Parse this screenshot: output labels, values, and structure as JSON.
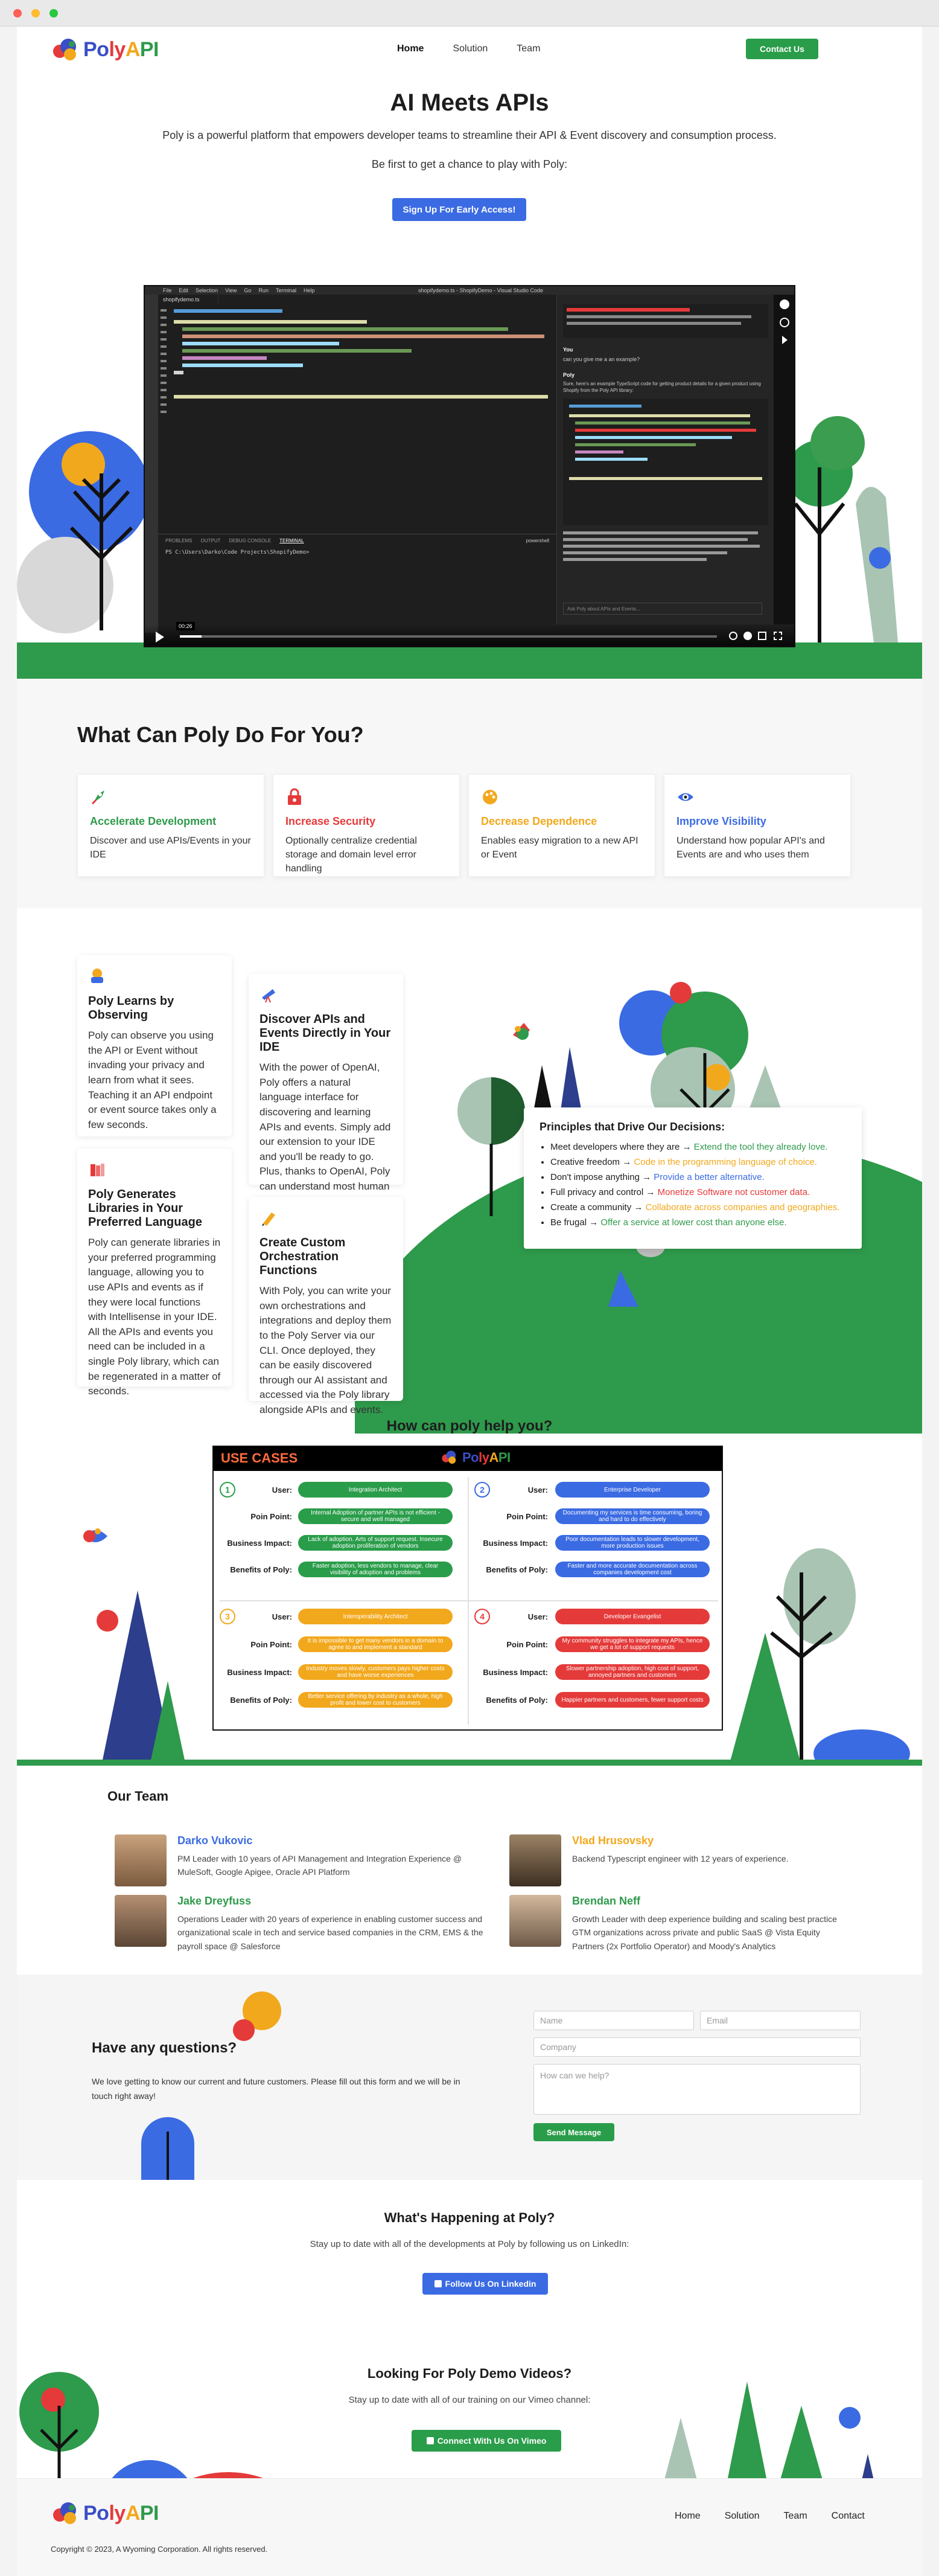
{
  "brand": {
    "word_parts": [
      "Po",
      "ly",
      "A",
      "PI"
    ],
    "colors": {
      "blue": "#3a4ec5",
      "red": "#e53a3a",
      "yellow": "#f2a81c",
      "green": "#2e9a4b"
    }
  },
  "nav": {
    "items": [
      "Home",
      "Solution",
      "Team"
    ],
    "contact_label": "Contact Us"
  },
  "hero": {
    "title": "AI Meets APIs",
    "subtitle": "Poly is a powerful platform that empowers developer teams to streamline their API & Event discovery and consumption process.",
    "tagline": "Be first to get a chance to play with Poly:",
    "cta_label": "Sign Up For Early Access!"
  },
  "video": {
    "menu": [
      "File",
      "Edit",
      "Selection",
      "View",
      "Go",
      "Run",
      "Terminal",
      "Help"
    ],
    "editor_tab": "shopifydemo.ts",
    "window_title": "shopifydemo.ts - ShopifyDemo - Visual Studio Code",
    "terminal_tabs": [
      "PROBLEMS",
      "OUTPUT",
      "DEBUG CONSOLE",
      "TERMINAL"
    ],
    "terminal_prompt": "PS C:\\Users\\Darko\\Code Projects\\ShopifyDemo>",
    "shell_label": "powershell",
    "chat_you_label": "You",
    "chat_you_text": "can you give me a an example?",
    "chat_poly_label": "Poly",
    "chat_poly_text": "Sure, here's an example TypeScript code for getting product details for a given product using Shopify from the Poly API library:",
    "chat_input_placeholder": "Ask Poly about APIs and Events...",
    "time": "00:26"
  },
  "can_do": {
    "title": "What Can Poly Do For You?",
    "features": [
      {
        "title": "Accelerate Development",
        "text": "Discover and use APIs/Events in your IDE",
        "color": "#2e9a4b",
        "icon": "rocket-icon"
      },
      {
        "title": "Increase Security",
        "text": "Optionally centralize credential storage and domain level error handling",
        "color": "#e53a3a",
        "icon": "lock-icon"
      },
      {
        "title": "Decrease Dependence",
        "text": "Enables easy migration to a new API or Event",
        "color": "#f2a81c",
        "icon": "palette-icon"
      },
      {
        "title": "Improve Visibility",
        "text": "Understand how popular API's and Events are and who uses them",
        "color": "#3b6be3",
        "icon": "eye-icon"
      }
    ]
  },
  "capabilities": [
    {
      "title": "Poly Learns by Observing",
      "text": "Poly can observe you using the API or Event without invading your privacy and learn from what it sees. Teaching it an API endpoint or event source takes only a few seconds.",
      "icon": "observe-icon"
    },
    {
      "title": "Discover APIs and Events Directly in Your IDE",
      "text": "With the power of OpenAI, Poly offers a natural language interface for discovering and learning APIs and events. Simply add our extension to your IDE and you'll be ready to go. Plus, thanks to OpenAI, Poly can understand most human languages.",
      "icon": "telescope-icon"
    },
    {
      "title": "Poly Generates Libraries in Your Preferred Language",
      "text": "Poly can generate libraries in your preferred programming language, allowing you to use APIs and events as if they were local functions with Intellisense in your IDE. All the APIs and events you need can be included in a single Poly library, which can be regenerated in a matter of seconds.",
      "icon": "books-icon"
    },
    {
      "title": "Create Custom Orchestration Functions",
      "text": "With Poly, you can write your own orchestrations and integrations and deploy them to the Poly Server via our CLI. Once deployed, they can be easily discovered through our AI assistant and accessed via the Poly library alongside APIs and events.",
      "icon": "pen-icon"
    }
  ],
  "principles": {
    "title": "Principles that Drive Our Decisions:",
    "items": [
      {
        "lead": "Meet developers where they are",
        "tail": "Extend the tool they already love.",
        "color": "#2e9a4b"
      },
      {
        "lead": "Creative freedom",
        "tail": "Code in the programming language of choice.",
        "color": "#f2a81c"
      },
      {
        "lead": "Don't impose anything",
        "tail": "Provide a better alternative.",
        "color": "#3b6be3"
      },
      {
        "lead": "Full privacy and control",
        "tail": "Monetize Software not customer data.",
        "color": "#e53a3a"
      },
      {
        "lead": "Create a community",
        "tail": "Collaborate across companies and geographies.",
        "color": "#f2a81c"
      },
      {
        "lead": "Be frugal",
        "tail": "Offer a service at lower cost than anyone else.",
        "color": "#2e9a4b"
      }
    ]
  },
  "help": {
    "title": "How can poly help you?",
    "banner": "USE CASES",
    "row_labels": [
      "User:",
      "Poin Point:",
      "Business Impact:",
      "Benefits of Poly:"
    ],
    "cases": [
      {
        "num": "1",
        "color": "#2a9d4a",
        "values": [
          "Integration Architect",
          "Internal Adoption of partner APIs is not efficient - secure and well managed",
          "Lack of adoption. Arts of support request. Insecure adoption proliferation of vendors",
          "Faster adoption, less vendors to manage, clear visibility of adoption and problems"
        ]
      },
      {
        "num": "2",
        "color": "#3b6be3",
        "values": [
          "Enterprise Developer",
          "Documenting my services is time consuming, boring and hard to do effectively",
          "Poor documentation leads to slower development, more production issues",
          "Faster and more accurate documentation across companies development cost"
        ]
      },
      {
        "num": "3",
        "color": "#f2a81c",
        "values": [
          "Interoperability Architect",
          "It is impossible to get many vendors in a domain to agree to and implement a standard",
          "Industry moves slowly, customers pays higher costs and have worse experiences",
          "Better service offering by industry as a whole, high profit and lower cost to customers"
        ]
      },
      {
        "num": "4",
        "color": "#e53a3a",
        "values": [
          "Developer Evangelist",
          "My community struggles to integrate my APIs, hence we get a lot of support requests",
          "Slower partnership adoption, high cost of support, annoyed partners and customers",
          "Happier partners and customers, fewer support costs"
        ]
      }
    ]
  },
  "team": {
    "title": "Our Team",
    "members": [
      {
        "name": "Darko Vukovic",
        "bio": "PM Leader with 10 years of API Management and Integration Experience @ MuleSoft, Google Apigee, Oracle API Platform",
        "name_color": "#3b6be3"
      },
      {
        "name": "Vlad Hrusovsky",
        "bio": "Backend Typescript engineer with 12 years of experience.",
        "name_color": "#f2a81c"
      },
      {
        "name": "Jake Dreyfuss",
        "bio": "Operations Leader with 20 years of experience in enabling customer success and organizational scale in tech and service based companies in the CRM, EMS & the payroll space @ Salesforce",
        "name_color": "#2e9a4b"
      },
      {
        "name": "Brendan Neff",
        "bio": "Growth Leader with deep experience building and scaling best practice GTM organizations across private and public SaaS @ Vista Equity Partners (2x Portfolio Operator) and Moody's Analytics",
        "name_color": "#2e9a4b"
      }
    ]
  },
  "contact": {
    "title": "Have any questions?",
    "text": "We love getting to know our current and future customers. Please fill out this form and we will be in touch right away!",
    "name_placeholder": "Name",
    "email_placeholder": "Email",
    "company_placeholder": "Company",
    "message_placeholder": "How can we help?",
    "submit_label": "Send Message"
  },
  "news": {
    "title": "What's Happening at Poly?",
    "text": "Stay up to date with all of the developments at Poly by following us on LinkedIn:",
    "cta_label": "Follow Us On Linkedin"
  },
  "demo": {
    "title": "Looking For Poly Demo Videos?",
    "text": "Stay up to date with all of our training on our Vimeo channel:",
    "cta_label": "Connect With Us On Vimeo"
  },
  "footer": {
    "items": [
      "Home",
      "Solution",
      "Team",
      "Contact"
    ],
    "copyright": "Copyright © 2023, A Wyoming Corporation. All rights reserved."
  }
}
